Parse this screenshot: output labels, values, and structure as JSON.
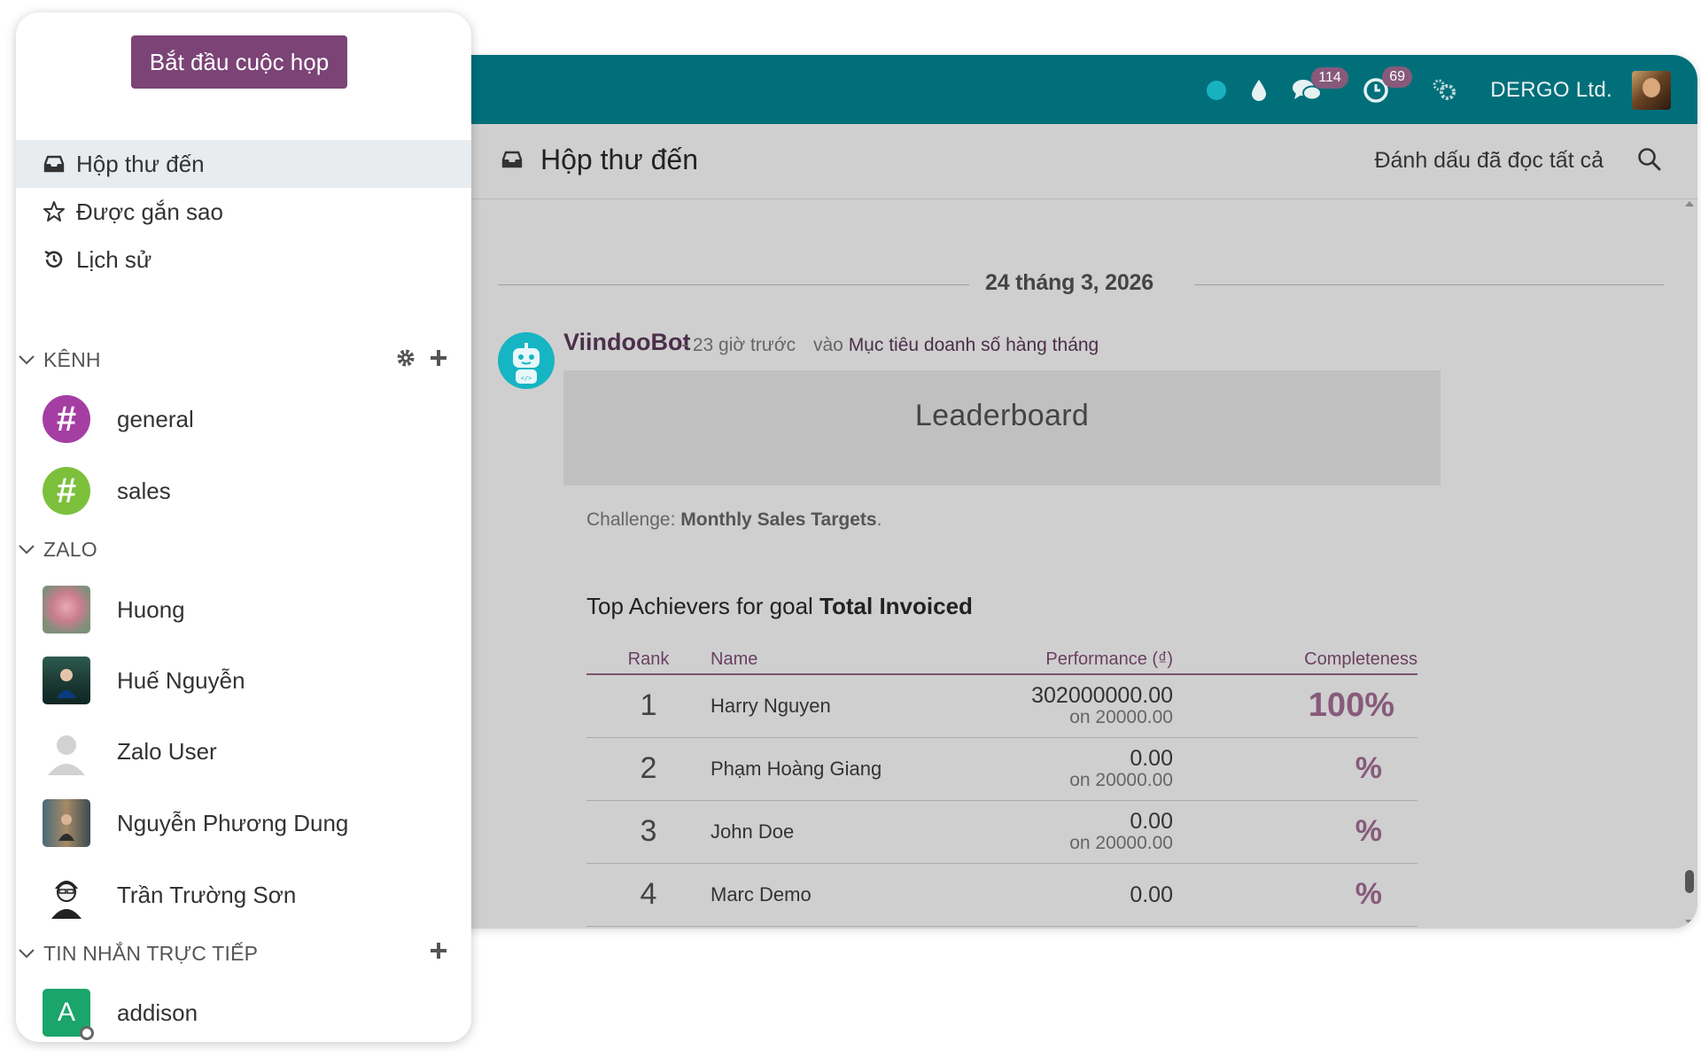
{
  "sidebar": {
    "start_meeting": "Bắt đầu cuộc họp",
    "nav": [
      {
        "label": "Hộp thư đến",
        "icon": "inbox-icon"
      },
      {
        "label": "Được gắn sao",
        "icon": "star-icon"
      },
      {
        "label": "Lịch sử",
        "icon": "history-icon"
      }
    ],
    "sections": {
      "channels": "KÊNH",
      "zalo": "ZALO",
      "direct": "TIN NHẮN TRỰC TIẾP"
    },
    "channels": [
      {
        "name": "general",
        "color": "#a43ea3"
      },
      {
        "name": "sales",
        "color": "#7cc03c"
      }
    ],
    "zalo": [
      {
        "name": "Huong"
      },
      {
        "name": "Huế Nguyễn"
      },
      {
        "name": "Zalo User"
      },
      {
        "name": "Nguyễn Phương Dung"
      },
      {
        "name": "Trần Trường Sơn"
      }
    ],
    "direct": [
      {
        "name": "addison",
        "initial": "A",
        "color": "#1aa56a"
      }
    ]
  },
  "topbar": {
    "chat_count": "114",
    "activity_count": "69",
    "company": "DERGO Ltd.",
    "color": "#016f7a"
  },
  "header": {
    "title": "Hộp thư đến",
    "mark_all_read": "Đánh dấu đã đọc tất cả"
  },
  "feed": {
    "date": "24 tháng 3, 2026",
    "message": {
      "author": "ViindooBot",
      "time": "- 23 giờ trước",
      "on": "vào",
      "record": "Mục tiêu doanh số hàng tháng",
      "banner": "Leaderboard",
      "challenge_label": "Challenge:",
      "challenge_name": "Monthly Sales Targets",
      "challenge_end": ".",
      "achievers_prefix": "Top Achievers for goal",
      "achievers_goal": "Total Invoiced"
    },
    "table": {
      "headers": {
        "rank": "Rank",
        "name": "Name",
        "performance": "Performance (₫)",
        "completeness": "Completeness"
      },
      "rows": [
        {
          "rank": "1",
          "name": "Harry Nguyen",
          "value": "302000000.00",
          "target": "on 20000.00",
          "completeness": "100%"
        },
        {
          "rank": "2",
          "name": "Phạm Hoàng Giang",
          "value": "0.00",
          "target": "on 20000.00",
          "completeness": "%"
        },
        {
          "rank": "3",
          "name": "John Doe",
          "value": "0.00",
          "target": "on 20000.00",
          "completeness": "%"
        },
        {
          "rank": "4",
          "name": "Marc Demo",
          "value": "0.00",
          "target": "",
          "completeness": "%"
        }
      ]
    }
  }
}
